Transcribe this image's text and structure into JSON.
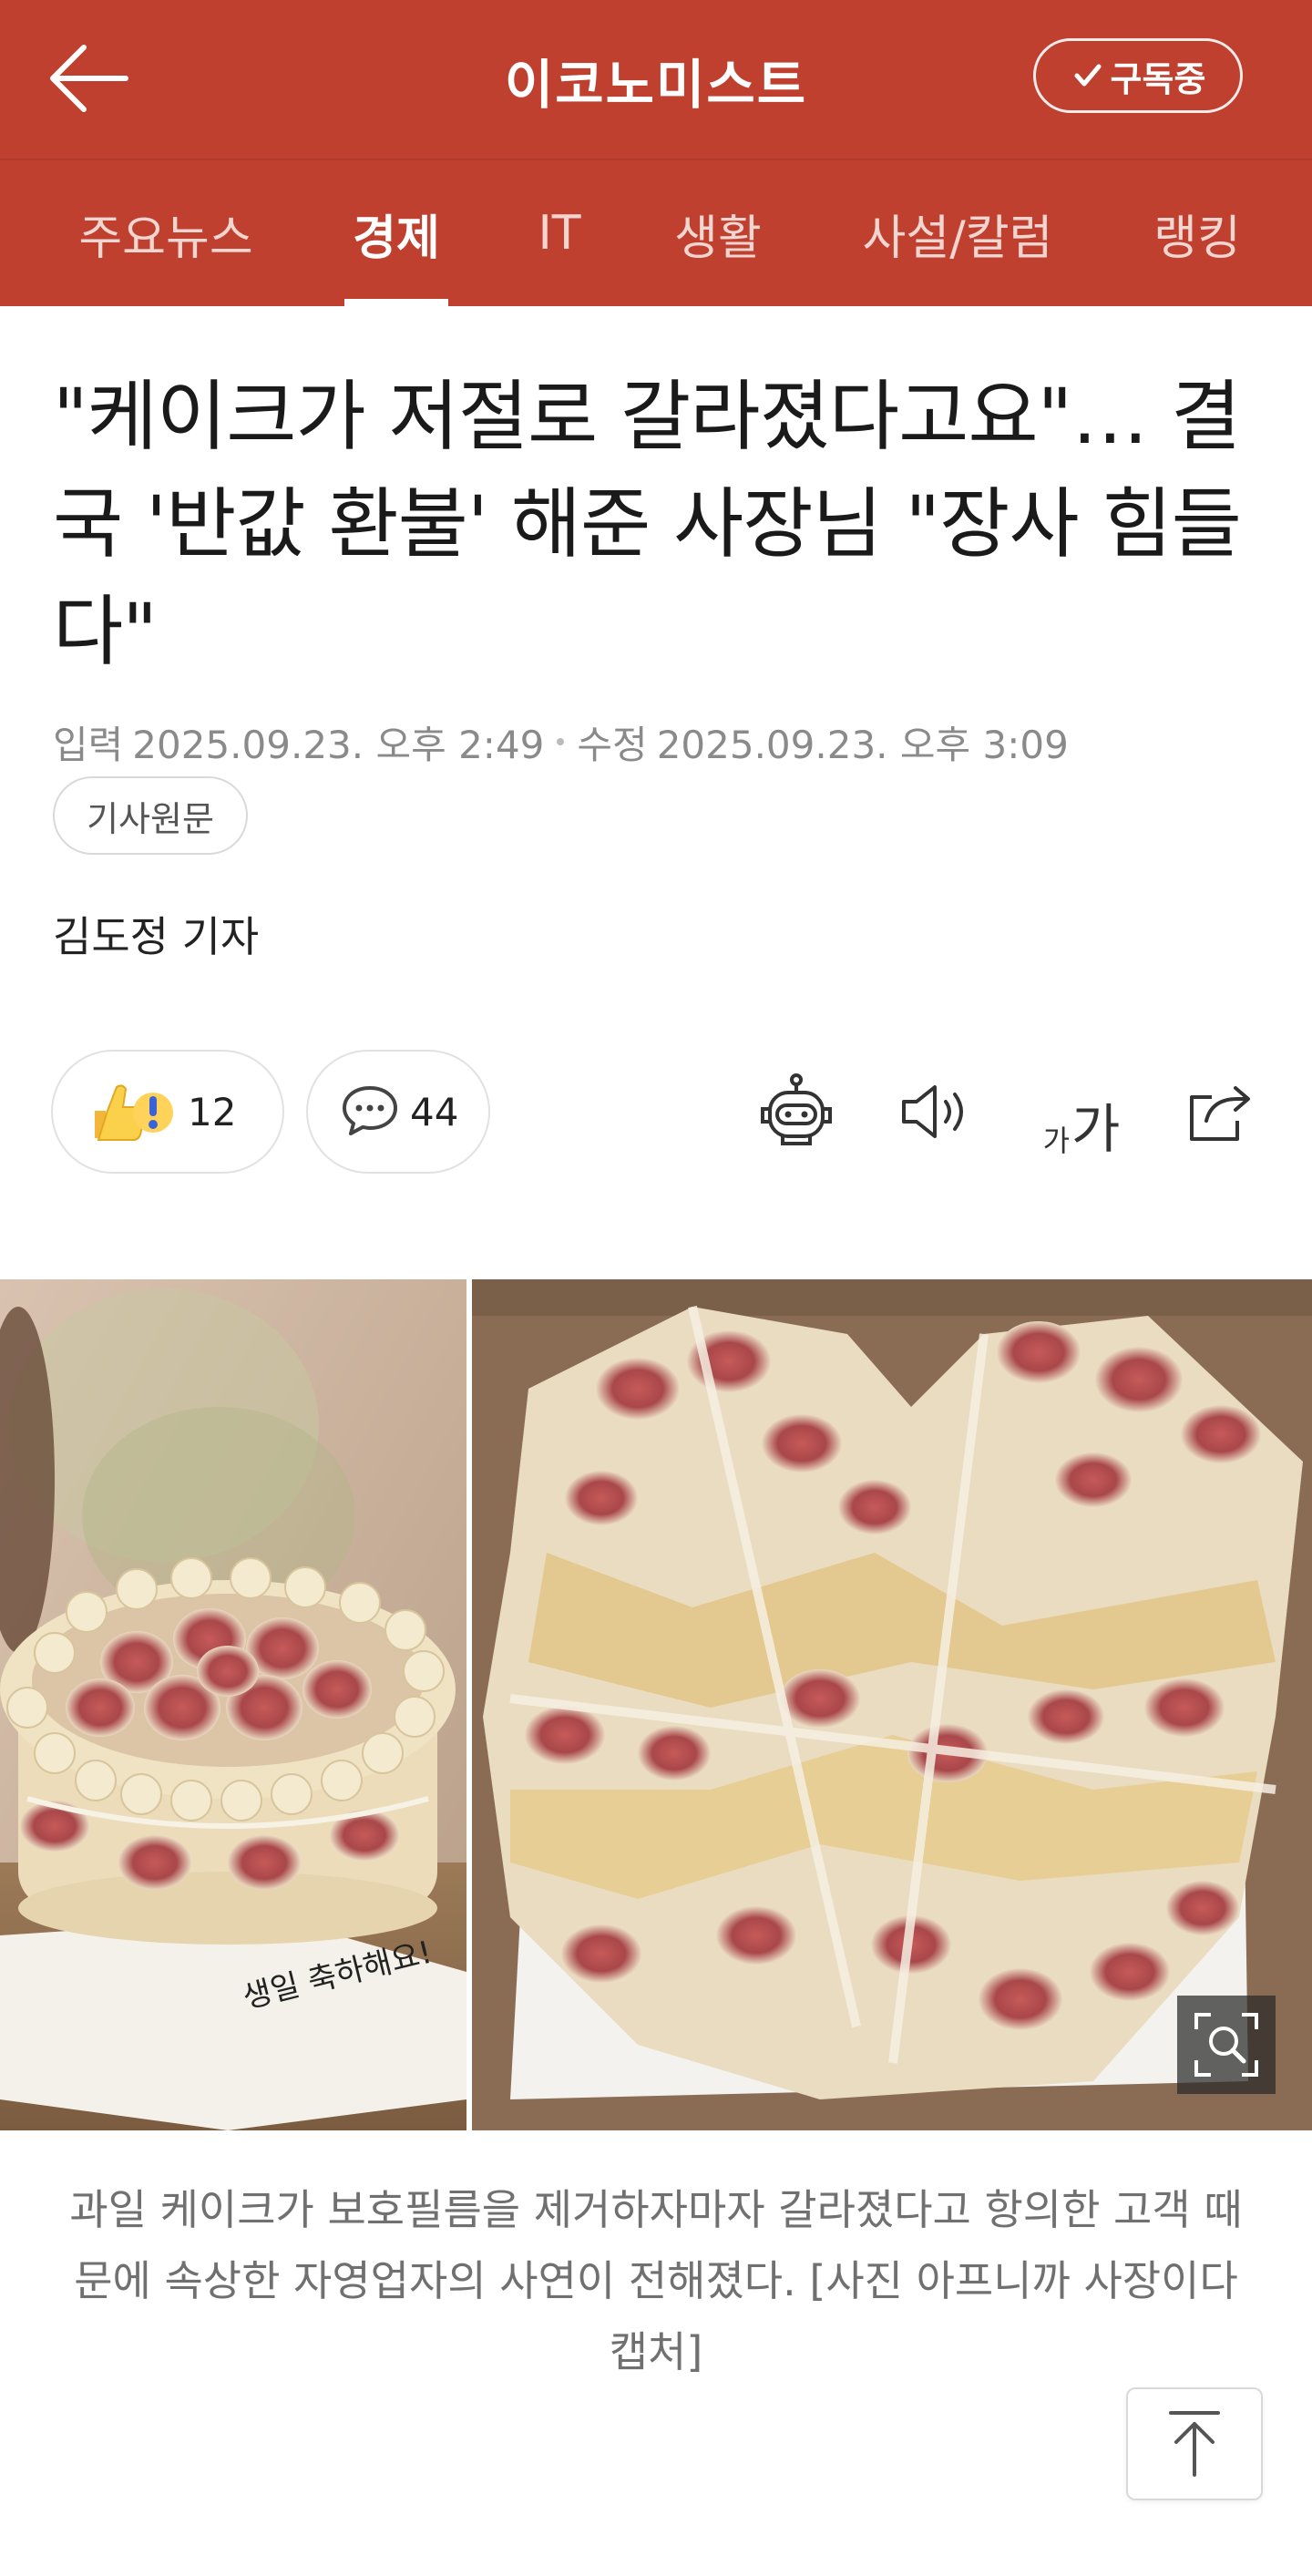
{
  "header": {
    "brand": "이코노미스트",
    "subscribe_label": "구독중"
  },
  "tabs": [
    {
      "label": "주요뉴스",
      "active": false
    },
    {
      "label": "경제",
      "active": true
    },
    {
      "label": "IT",
      "active": false
    },
    {
      "label": "생활",
      "active": false
    },
    {
      "label": "사설/칼럼",
      "active": false
    },
    {
      "label": "랭킹",
      "active": false
    }
  ],
  "article": {
    "headline": "\"케이크가 저절로 갈라졌다고요\"… 결국 '반값 환불' 해준 사장님 \"장사 힘들다\"",
    "input_label": "입력",
    "input_date": "2025.09.23. 오후 2:49",
    "modified_label": "수정",
    "modified_date": "2025.09.23. 오후 3:09",
    "original_button": "기사원문",
    "byline": "김도정 기자"
  },
  "actions": {
    "reaction_count": "12",
    "comment_count": "44",
    "font_small": "가",
    "font_large": "가"
  },
  "icons": {
    "back": "back-arrow-icon",
    "check": "check-icon",
    "reaction": "thumbs-up-icon",
    "comment": "comment-bubble-icon",
    "summary_bot": "robot-icon",
    "tts": "speaker-icon",
    "share": "share-icon",
    "zoom": "zoom-icon",
    "scroll_top": "arrow-up-icon"
  },
  "colors": {
    "brand": "#c0402f",
    "header_text": "#ffffff"
  },
  "photo": {
    "caption": "과일 케이크가 보호필름을 제거하자마자 갈라졌다고 항의한 고객 때문에 속상한 자영업자의 사연이 전해졌다. [사진 아프니까 사장이다 캡처]",
    "cake_plate_text": "생일 축하해요!"
  }
}
